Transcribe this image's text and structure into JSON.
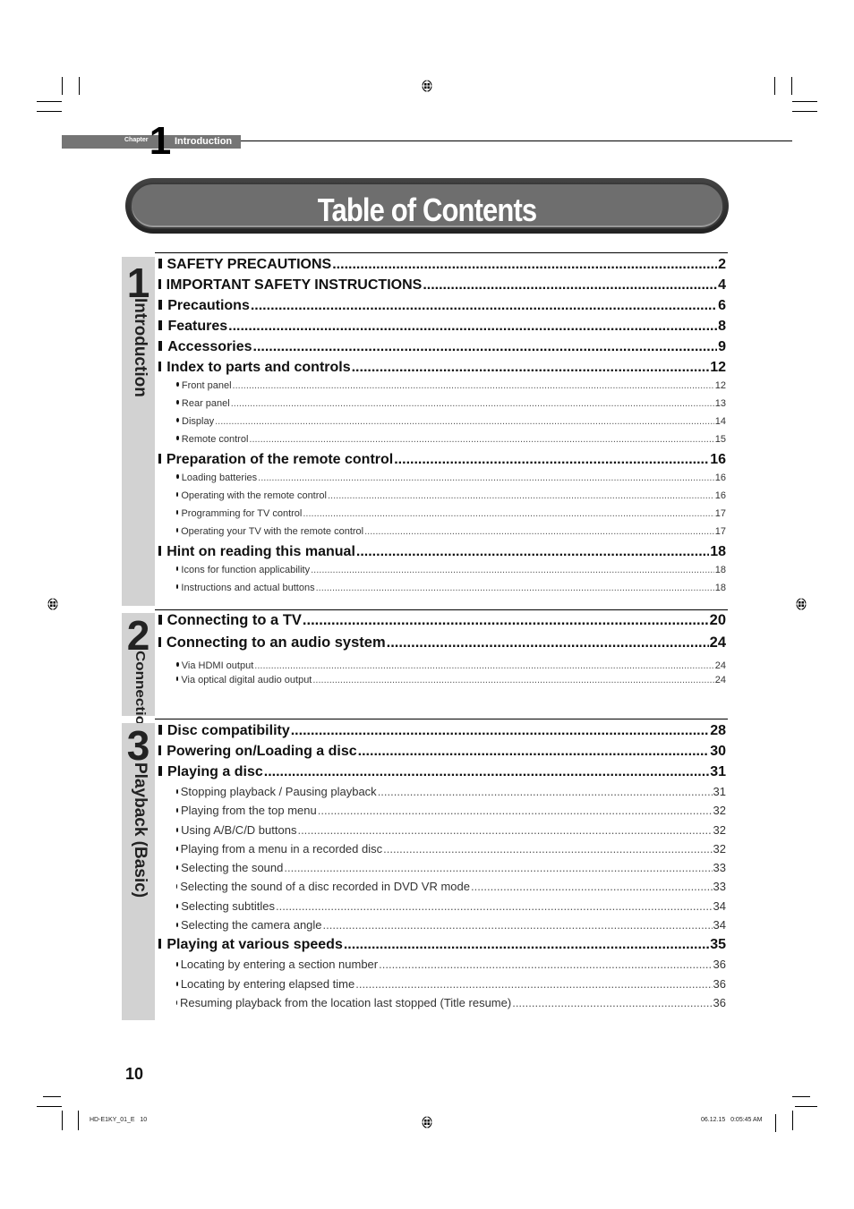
{
  "chapter": {
    "word": "Chapter",
    "number": "1",
    "name": "Introduction"
  },
  "title": "Table of Contents",
  "sections": [
    {
      "number": "1",
      "label": "Introduction",
      "entries": [
        {
          "type": "main",
          "text": "SAFETY PRECAUTIONS",
          "page": "2"
        },
        {
          "type": "main",
          "text": "IMPORTANT SAFETY INSTRUCTIONS",
          "page": "4"
        },
        {
          "type": "main",
          "text": "Precautions",
          "page": "6"
        },
        {
          "type": "main",
          "text": "Features",
          "page": "8"
        },
        {
          "type": "main",
          "text": "Accessories",
          "page": "9"
        },
        {
          "type": "main",
          "text": "Index to parts and controls",
          "page": "12"
        },
        {
          "type": "sub",
          "text": "Front panel",
          "page": "12"
        },
        {
          "type": "sub",
          "text": "Rear panel",
          "page": "13"
        },
        {
          "type": "sub",
          "text": "Display",
          "page": "14"
        },
        {
          "type": "sub",
          "text": "Remote control",
          "page": "15"
        },
        {
          "type": "main",
          "text": "Preparation of the remote control",
          "page": "16"
        },
        {
          "type": "sub",
          "text": "Loading batteries",
          "page": "16"
        },
        {
          "type": "sub",
          "text": "Operating with the remote control",
          "page": "16"
        },
        {
          "type": "sub",
          "text": "Programming for TV control",
          "page": "17"
        },
        {
          "type": "sub",
          "text": "Operating your TV with the remote control",
          "page": "17"
        },
        {
          "type": "main",
          "text": "Hint on reading this manual",
          "page": "18"
        },
        {
          "type": "sub",
          "text": "Icons for function applicability",
          "page": "18"
        },
        {
          "type": "sub",
          "text": "Instructions and actual buttons",
          "page": "18"
        }
      ]
    },
    {
      "number": "2",
      "label": "Connections",
      "entries": [
        {
          "type": "main",
          "text": "Connecting to a TV",
          "page": "20"
        },
        {
          "type": "main",
          "text": "Connecting to an audio system",
          "page": "24"
        },
        {
          "type": "sub",
          "text": "Via HDMI output",
          "page": "24"
        },
        {
          "type": "sub",
          "text": "Via optical digital audio output",
          "page": "24"
        }
      ]
    },
    {
      "number": "3",
      "label": "Playback (Basic)",
      "entries": [
        {
          "type": "main",
          "text": "Disc compatibility",
          "page": "28"
        },
        {
          "type": "main",
          "text": "Powering on/Loading a disc",
          "page": "30"
        },
        {
          "type": "main",
          "text": "Playing a disc",
          "page": "31"
        },
        {
          "type": "sub",
          "text": "Stopping playback / Pausing playback",
          "page": "31"
        },
        {
          "type": "sub",
          "text": "Playing from the top menu",
          "page": "32"
        },
        {
          "type": "sub",
          "text": "Using A/B/C/D buttons",
          "page": "32"
        },
        {
          "type": "sub",
          "text": "Playing from a menu in a recorded disc",
          "page": "32"
        },
        {
          "type": "sub",
          "text": "Selecting the sound",
          "page": "33"
        },
        {
          "type": "sub",
          "text": "Selecting the sound of a disc recorded in DVD VR mode",
          "page": "33"
        },
        {
          "type": "sub",
          "text": "Selecting subtitles",
          "page": "34"
        },
        {
          "type": "sub",
          "text": "Selecting the camera angle",
          "page": "34"
        },
        {
          "type": "main",
          "text": "Playing at various speeds",
          "page": "35"
        },
        {
          "type": "sub",
          "text": "Locating by entering a section number",
          "page": "36"
        },
        {
          "type": "sub",
          "text": "Locating by entering elapsed time",
          "page": "36"
        },
        {
          "type": "sub",
          "text": "Resuming playback from the location last stopped (Title resume)",
          "page": "36"
        }
      ]
    }
  ],
  "footer": {
    "page_number": "10",
    "file_id": "HD-E1KY_01_E   10",
    "timestamp": "06.12.15   0:05:45 AM"
  }
}
